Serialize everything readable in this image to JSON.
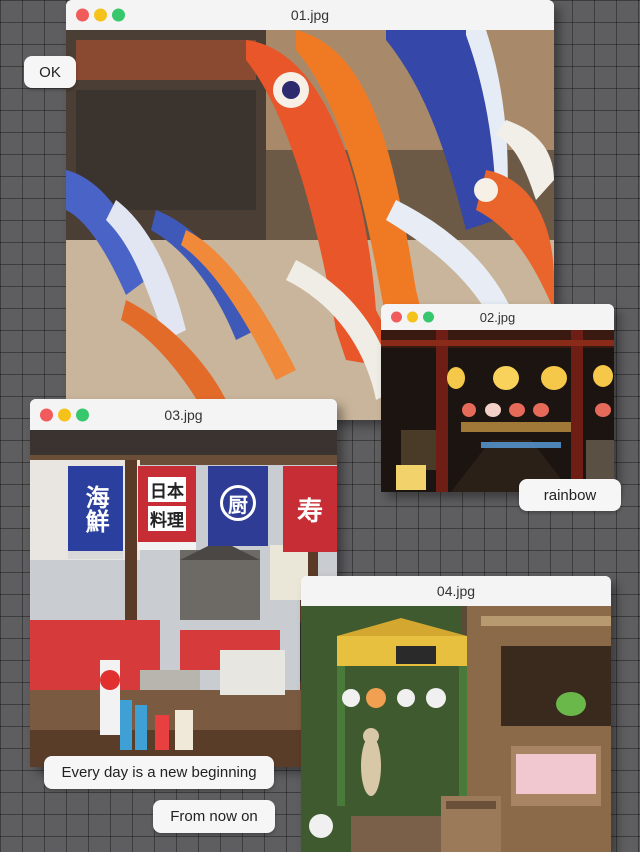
{
  "windows": [
    {
      "title": "01.jpg",
      "image": "koinobori carp streamers"
    },
    {
      "title": "02.jpg",
      "image": "lantern-lit shrine walkway"
    },
    {
      "title": "03.jpg",
      "image": "food stall with noren banners"
    },
    {
      "title": "04.jpg",
      "image": "wooden hut with cat figurines"
    }
  ],
  "labels": {
    "ok": "OK",
    "rainbow": "rainbow",
    "every_day": "Every day is a new beginning",
    "from_now": "From now on"
  },
  "banners": {
    "b1": "海鮮",
    "b2a": "日本",
    "b2b": "料理",
    "b3": "厨",
    "b4": "寿"
  },
  "colors": {
    "traffic_red": "#f15b5b",
    "traffic_yellow": "#f4c21b",
    "traffic_green": "#37c76d",
    "background": "#5e5e60"
  }
}
